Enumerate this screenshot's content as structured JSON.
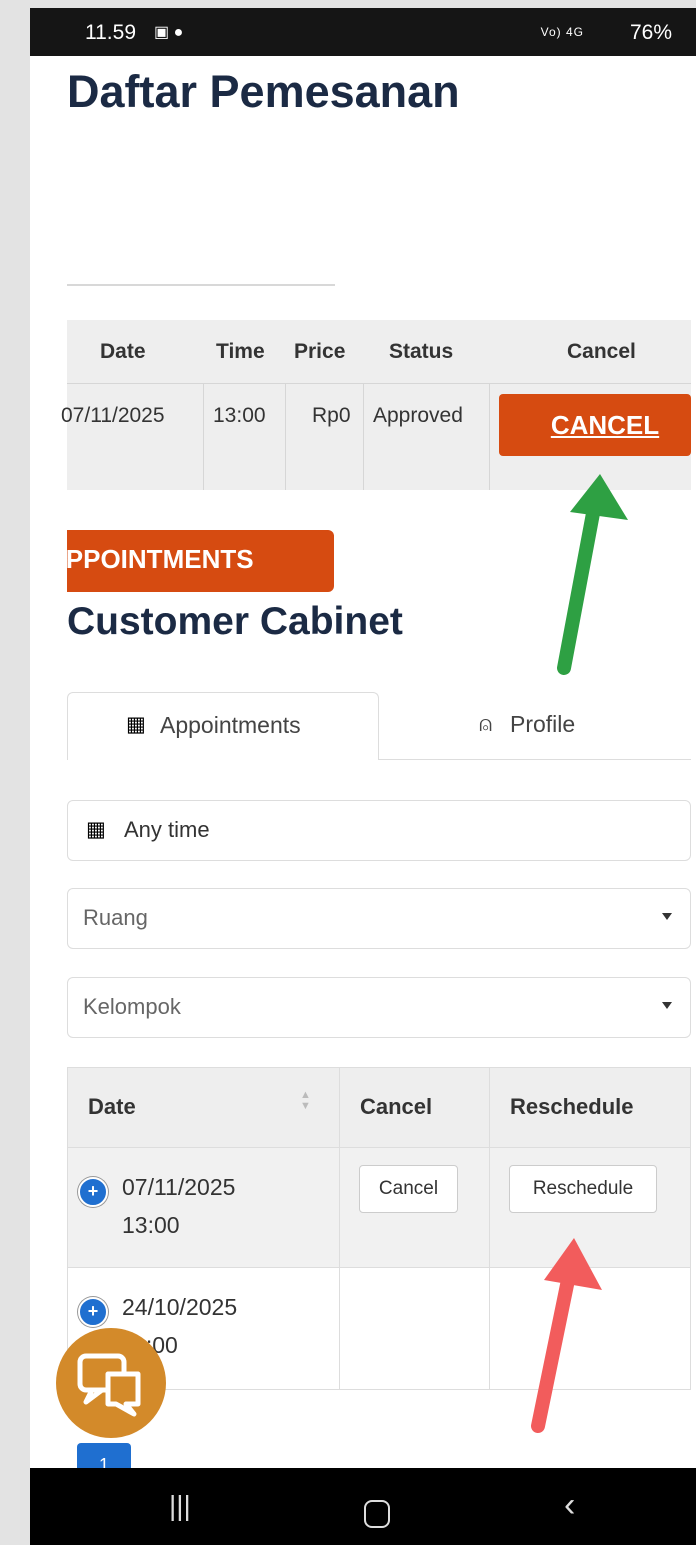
{
  "status_bar": {
    "time": "11.59",
    "net": "Vo) 4G",
    "battery": "76%"
  },
  "page": {
    "title": "Daftar Pemesanan"
  },
  "booking_table": {
    "headers": [
      "Date",
      "Time",
      "Price",
      "Status",
      "Cancel"
    ],
    "row": {
      "date": "07/11/2025",
      "time": "13:00",
      "price": "Rp0",
      "status": "Approved"
    },
    "cancel_label": "CANCEL",
    "cancel_color": "#d64b11"
  },
  "appointments_banner": "APPOINTMENTS",
  "cabinet_title": "Customer Cabinet",
  "tabs": {
    "appointments": "Appointments",
    "profile": "Profile"
  },
  "filters": {
    "date": "Any time",
    "room": "Ruang",
    "group": "Kelompok"
  },
  "appointments_table": {
    "headers": [
      "Date",
      "Cancel",
      "Reschedule"
    ],
    "rows": [
      {
        "date": "07/11/2025",
        "time": "13:00",
        "cancel": "Cancel",
        "reschedule": "Reschedule"
      },
      {
        "date": "24/10/2025",
        "time": "11:00"
      }
    ]
  },
  "pagination": {
    "current": "1"
  },
  "annotations": {
    "green_arrow": "#2ea043",
    "red_arrow": "#f25c5c"
  }
}
